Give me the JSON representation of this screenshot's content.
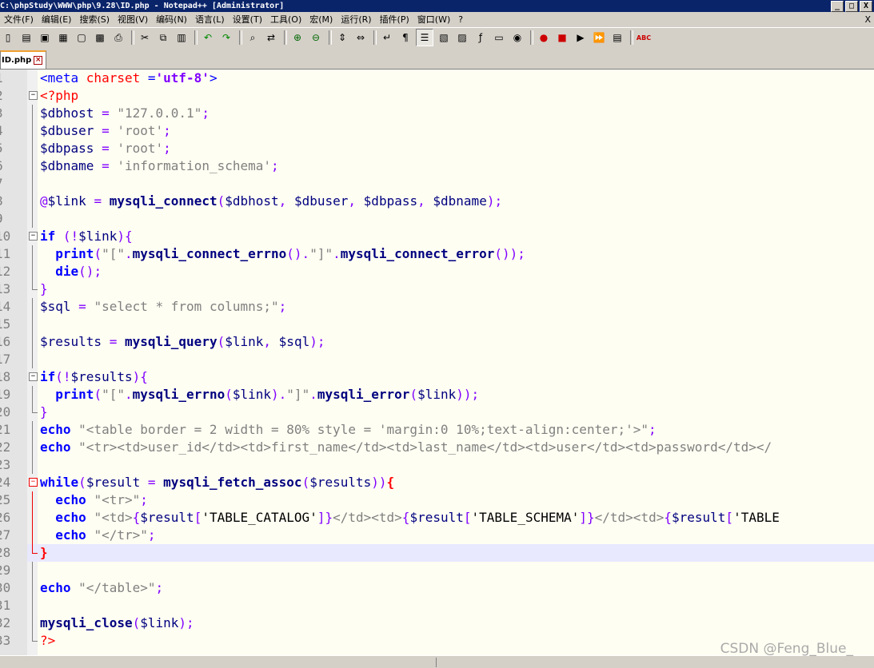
{
  "window": {
    "title": "C:\\phpStudy\\WWW\\php\\9.28\\ID.php - Notepad++ [Administrator]",
    "buttons": [
      "_",
      "□",
      "X"
    ]
  },
  "menu": {
    "items": [
      "文件(F)",
      "编辑(E)",
      "搜索(S)",
      "视图(V)",
      "编码(N)",
      "语言(L)",
      "设置(T)",
      "工具(O)",
      "宏(M)",
      "运行(R)",
      "插件(P)",
      "窗口(W)",
      "?"
    ],
    "close": "X"
  },
  "toolbar": {
    "icons": [
      "new-file",
      "open-file",
      "save",
      "save-all",
      "close",
      "close-all",
      "print",
      "sep",
      "cut",
      "copy",
      "paste",
      "sep",
      "undo",
      "redo",
      "sep",
      "find",
      "replace",
      "sep",
      "zoom-in",
      "zoom-out",
      "sep",
      "sync-v",
      "sync-h",
      "sep",
      "word-wrap",
      "show-all",
      "indent-guide",
      "user-lang",
      "doc-map",
      "function-list",
      "folder-workspace",
      "monitor",
      "sep",
      "record",
      "stop",
      "play",
      "play-multi",
      "save-macro",
      "sep",
      "spell-check"
    ],
    "glyphs": {
      "new-file": "▯",
      "open-file": "▤",
      "save": "▣",
      "save-all": "▦",
      "close": "▢",
      "close-all": "▩",
      "print": "⎙",
      "cut": "✂",
      "copy": "⧉",
      "paste": "▥",
      "undo": "↶",
      "redo": "↷",
      "find": "⌕",
      "replace": "⇄",
      "zoom-in": "⊕",
      "zoom-out": "⊖",
      "sync-v": "⇕",
      "sync-h": "⇔",
      "word-wrap": "↵",
      "show-all": "¶",
      "indent-guide": "☰",
      "user-lang": "▧",
      "doc-map": "▨",
      "function-list": "ƒ",
      "folder-workspace": "▭",
      "monitor": "◉",
      "record": "●",
      "stop": "■",
      "play": "▶",
      "play-multi": "⏩",
      "save-macro": "▤",
      "spell-check": "ABC"
    }
  },
  "tab": {
    "label": "ID.php",
    "close": "×"
  },
  "editor": {
    "lines": [
      {
        "n": "1",
        "fold": "",
        "tokens": [
          [
            "t-tag",
            "<meta "
          ],
          [
            "t-attr",
            "charset"
          ],
          [
            "t-tag",
            " ="
          ],
          [
            "t-str",
            "'utf-8'"
          ],
          [
            "t-tag",
            ">"
          ]
        ]
      },
      {
        "n": "2",
        "fold": "box",
        "tokens": [
          [
            "t-php",
            "<?php"
          ]
        ]
      },
      {
        "n": "3",
        "fold": "vline",
        "tokens": [
          [
            "t-var",
            "$dbhost"
          ],
          [
            "t-plain",
            " "
          ],
          [
            "t-op",
            "="
          ],
          [
            "t-plain",
            " "
          ],
          [
            "t-dstr",
            "\"127.0.0.1\""
          ],
          [
            "t-op",
            ";"
          ]
        ]
      },
      {
        "n": "4",
        "fold": "vline",
        "tokens": [
          [
            "t-var",
            "$dbuser"
          ],
          [
            "t-plain",
            " "
          ],
          [
            "t-op",
            "="
          ],
          [
            "t-plain",
            " "
          ],
          [
            "t-sstr",
            "'root'"
          ],
          [
            "t-op",
            ";"
          ]
        ]
      },
      {
        "n": "5",
        "fold": "vline",
        "tokens": [
          [
            "t-var",
            "$dbpass"
          ],
          [
            "t-plain",
            " "
          ],
          [
            "t-op",
            "="
          ],
          [
            "t-plain",
            " "
          ],
          [
            "t-sstr",
            "'root'"
          ],
          [
            "t-op",
            ";"
          ]
        ]
      },
      {
        "n": "6",
        "fold": "vline",
        "tokens": [
          [
            "t-var",
            "$dbname"
          ],
          [
            "t-plain",
            " "
          ],
          [
            "t-op",
            "="
          ],
          [
            "t-plain",
            " "
          ],
          [
            "t-sstr",
            "'information_schema'"
          ],
          [
            "t-op",
            ";"
          ]
        ]
      },
      {
        "n": "7",
        "fold": "vline",
        "tokens": []
      },
      {
        "n": "8",
        "fold": "vline",
        "tokens": [
          [
            "t-op",
            "@"
          ],
          [
            "t-var",
            "$link"
          ],
          [
            "t-plain",
            " "
          ],
          [
            "t-op",
            "="
          ],
          [
            "t-plain",
            " "
          ],
          [
            "t-fn",
            "mysqli_connect"
          ],
          [
            "t-op",
            "("
          ],
          [
            "t-var",
            "$dbhost"
          ],
          [
            "t-op",
            ","
          ],
          [
            "t-plain",
            " "
          ],
          [
            "t-var",
            "$dbuser"
          ],
          [
            "t-op",
            ","
          ],
          [
            "t-plain",
            " "
          ],
          [
            "t-var",
            "$dbpass"
          ],
          [
            "t-op",
            ","
          ],
          [
            "t-plain",
            " "
          ],
          [
            "t-var",
            "$dbname"
          ],
          [
            "t-op",
            ");"
          ]
        ]
      },
      {
        "n": "9",
        "fold": "vline",
        "tokens": []
      },
      {
        "n": "10",
        "fold": "box",
        "tokens": [
          [
            "t-kw",
            "if"
          ],
          [
            "t-plain",
            " "
          ],
          [
            "t-op",
            "(!"
          ],
          [
            "t-var",
            "$link"
          ],
          [
            "t-op",
            "){"
          ]
        ]
      },
      {
        "n": "11",
        "fold": "vline",
        "tokens": [
          [
            "t-plain",
            "  "
          ],
          [
            "t-kw",
            "print"
          ],
          [
            "t-op",
            "("
          ],
          [
            "t-dstr",
            "\"[\""
          ],
          [
            "t-op",
            "."
          ],
          [
            "t-fn",
            "mysqli_connect_errno"
          ],
          [
            "t-op",
            "()."
          ],
          [
            "t-dstr",
            "\"]\""
          ],
          [
            "t-op",
            "."
          ],
          [
            "t-fn",
            "mysqli_connect_error"
          ],
          [
            "t-op",
            "());"
          ]
        ]
      },
      {
        "n": "12",
        "fold": "vline",
        "tokens": [
          [
            "t-plain",
            "  "
          ],
          [
            "t-kw",
            "die"
          ],
          [
            "t-op",
            "();"
          ]
        ]
      },
      {
        "n": "13",
        "fold": "end",
        "tokens": [
          [
            "t-op",
            "}"
          ]
        ]
      },
      {
        "n": "14",
        "fold": "vline",
        "tokens": [
          [
            "t-var",
            "$sql"
          ],
          [
            "t-plain",
            " "
          ],
          [
            "t-op",
            "="
          ],
          [
            "t-plain",
            " "
          ],
          [
            "t-dstr",
            "\"select * from columns;\""
          ],
          [
            "t-op",
            ";"
          ]
        ]
      },
      {
        "n": "15",
        "fold": "vline",
        "tokens": []
      },
      {
        "n": "16",
        "fold": "vline",
        "tokens": [
          [
            "t-var",
            "$results"
          ],
          [
            "t-plain",
            " "
          ],
          [
            "t-op",
            "="
          ],
          [
            "t-plain",
            " "
          ],
          [
            "t-fn",
            "mysqli_query"
          ],
          [
            "t-op",
            "("
          ],
          [
            "t-var",
            "$link"
          ],
          [
            "t-op",
            ","
          ],
          [
            "t-plain",
            " "
          ],
          [
            "t-var",
            "$sql"
          ],
          [
            "t-op",
            ");"
          ]
        ]
      },
      {
        "n": "17",
        "fold": "vline",
        "tokens": []
      },
      {
        "n": "18",
        "fold": "box",
        "tokens": [
          [
            "t-kw",
            "if"
          ],
          [
            "t-op",
            "(!"
          ],
          [
            "t-var",
            "$results"
          ],
          [
            "t-op",
            "){"
          ]
        ]
      },
      {
        "n": "19",
        "fold": "vline",
        "tokens": [
          [
            "t-plain",
            "  "
          ],
          [
            "t-kw",
            "print"
          ],
          [
            "t-op",
            "("
          ],
          [
            "t-dstr",
            "\"[\""
          ],
          [
            "t-op",
            "."
          ],
          [
            "t-fn",
            "mysqli_errno"
          ],
          [
            "t-op",
            "("
          ],
          [
            "t-var",
            "$link"
          ],
          [
            "t-op",
            ")."
          ],
          [
            "t-dstr",
            "\"]\""
          ],
          [
            "t-op",
            "."
          ],
          [
            "t-fn",
            "mysqli_error"
          ],
          [
            "t-op",
            "("
          ],
          [
            "t-var",
            "$link"
          ],
          [
            "t-op",
            "));"
          ]
        ]
      },
      {
        "n": "20",
        "fold": "end",
        "tokens": [
          [
            "t-op",
            "}"
          ]
        ]
      },
      {
        "n": "21",
        "fold": "vline",
        "tokens": [
          [
            "t-kw",
            "echo"
          ],
          [
            "t-plain",
            " "
          ],
          [
            "t-dstr",
            "\"<table border = 2 width = 80% style = 'margin:0 10%;text-align:center;'>\""
          ],
          [
            "t-op",
            ";"
          ]
        ]
      },
      {
        "n": "22",
        "fold": "vline",
        "tokens": [
          [
            "t-kw",
            "echo"
          ],
          [
            "t-plain",
            " "
          ],
          [
            "t-dstr",
            "\"<tr><td>user_id</td><td>first_name</td><td>last_name</td><td>user</td><td>password</td></"
          ]
        ]
      },
      {
        "n": "23",
        "fold": "vline",
        "tokens": []
      },
      {
        "n": "24",
        "fold": "box-red",
        "tokens": [
          [
            "t-kw",
            "while"
          ],
          [
            "t-op",
            "("
          ],
          [
            "t-var",
            "$result"
          ],
          [
            "t-plain",
            " "
          ],
          [
            "t-op",
            "="
          ],
          [
            "t-plain",
            " "
          ],
          [
            "t-fn",
            "mysqli_fetch_assoc"
          ],
          [
            "t-op",
            "("
          ],
          [
            "t-var",
            "$results"
          ],
          [
            "t-op",
            "))"
          ],
          [
            "t-brace-red",
            "{"
          ]
        ]
      },
      {
        "n": "25",
        "fold": "vline-red",
        "tokens": [
          [
            "t-plain",
            "  "
          ],
          [
            "t-kw",
            "echo"
          ],
          [
            "t-plain",
            " "
          ],
          [
            "t-dstr",
            "\"<tr>\""
          ],
          [
            "t-op",
            ";"
          ]
        ]
      },
      {
        "n": "26",
        "fold": "vline-red",
        "tokens": [
          [
            "t-plain",
            "  "
          ],
          [
            "t-kw",
            "echo"
          ],
          [
            "t-plain",
            " "
          ],
          [
            "t-dstr",
            "\"<td>"
          ],
          [
            "t-op",
            "{"
          ],
          [
            "t-var",
            "$result"
          ],
          [
            "t-op",
            "["
          ],
          [
            "t-plain",
            "'TABLE_CATALOG'"
          ],
          [
            "t-op",
            "]}"
          ],
          [
            "t-dstr",
            "</td><td>"
          ],
          [
            "t-op",
            "{"
          ],
          [
            "t-var",
            "$result"
          ],
          [
            "t-op",
            "["
          ],
          [
            "t-plain",
            "'TABLE_SCHEMA'"
          ],
          [
            "t-op",
            "]}"
          ],
          [
            "t-dstr",
            "</td><td>"
          ],
          [
            "t-op",
            "{"
          ],
          [
            "t-var",
            "$result"
          ],
          [
            "t-op",
            "["
          ],
          [
            "t-plain",
            "'TABLE"
          ]
        ]
      },
      {
        "n": "27",
        "fold": "vline-red",
        "tokens": [
          [
            "t-plain",
            "  "
          ],
          [
            "t-kw",
            "echo"
          ],
          [
            "t-plain",
            " "
          ],
          [
            "t-dstr",
            "\"</tr>\""
          ],
          [
            "t-op",
            ";"
          ]
        ]
      },
      {
        "n": "28",
        "fold": "end-red",
        "current": true,
        "tokens": [
          [
            "t-brace-red",
            "}"
          ]
        ]
      },
      {
        "n": "29",
        "fold": "vline",
        "tokens": []
      },
      {
        "n": "30",
        "fold": "vline",
        "tokens": [
          [
            "t-kw",
            "echo"
          ],
          [
            "t-plain",
            " "
          ],
          [
            "t-dstr",
            "\"</table>\""
          ],
          [
            "t-op",
            ";"
          ]
        ]
      },
      {
        "n": "31",
        "fold": "vline",
        "tokens": []
      },
      {
        "n": "32",
        "fold": "vline",
        "tokens": [
          [
            "t-fn",
            "mysqli_close"
          ],
          [
            "t-op",
            "("
          ],
          [
            "t-var",
            "$link"
          ],
          [
            "t-op",
            ");"
          ]
        ]
      },
      {
        "n": "33",
        "fold": "end",
        "tokens": [
          [
            "t-php",
            "?>"
          ]
        ]
      }
    ]
  },
  "watermark": "CSDN @Feng_Blue_"
}
